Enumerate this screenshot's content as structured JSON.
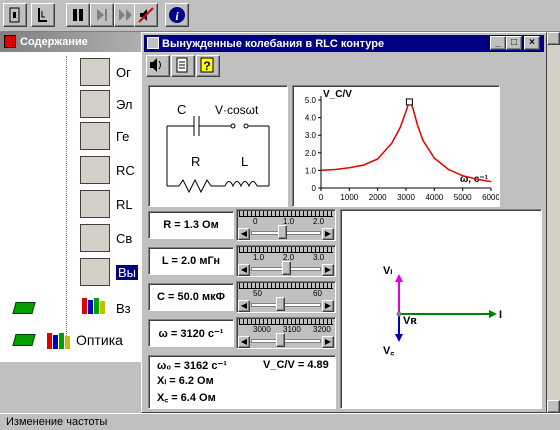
{
  "toolbar": {
    "buttons": [
      "exit-icon",
      "bookmark-icon",
      "pause-icon",
      "step-icon",
      "fast-forward-icon",
      "no-sound-icon",
      "info-icon"
    ]
  },
  "tree": {
    "title": "Содержание",
    "items": [
      {
        "label": "Ог"
      },
      {
        "label": "Эл"
      },
      {
        "label": "Ге"
      },
      {
        "label": "RC"
      },
      {
        "label": "RL"
      },
      {
        "label": "Св"
      },
      {
        "label": "Вы"
      },
      {
        "label": "Вз"
      }
    ],
    "optika": "Оптика"
  },
  "window": {
    "title": "Вынужденные колебания в RLC контуре"
  },
  "circuit": {
    "c": "C",
    "source": "V·cosωt",
    "r": "R",
    "l": "L"
  },
  "chart_data": {
    "type": "line",
    "ylabel": "V_C/V",
    "xlabel": "ω, с⁻¹",
    "xlim": [
      0,
      6000
    ],
    "ylim": [
      0,
      5
    ],
    "xticks": [
      "0",
      "1000",
      "2000",
      "3000",
      "4000",
      "5000",
      "6000"
    ],
    "yticks": [
      "0",
      "1.0",
      "2.0",
      "3.0",
      "4.0",
      "5.0"
    ],
    "series": [
      {
        "x": [
          0,
          500,
          1000,
          1500,
          2000,
          2500,
          2800,
          3000,
          3100,
          3120,
          3162,
          3250,
          3400,
          3600,
          4000,
          4500,
          5000,
          5500,
          6000
        ],
        "y": [
          1.0,
          1.05,
          1.15,
          1.3,
          1.65,
          2.55,
          3.45,
          4.35,
          4.85,
          4.89,
          4.85,
          4.5,
          3.6,
          2.7,
          1.7,
          1.05,
          0.7,
          0.5,
          0.36
        ]
      }
    ],
    "marker": {
      "x": 3120,
      "y": 4.89
    },
    "color": "#e00000"
  },
  "params": [
    {
      "label": "R = 1.3 Ом",
      "scale": [
        "0",
        "1.0",
        "2.0"
      ],
      "value": 0.43
    },
    {
      "label": "L = 2.0 мГн",
      "scale": [
        "1.0",
        "2.0",
        "3.0"
      ],
      "value": 0.5
    },
    {
      "label": "C = 50.0 мкФ",
      "scale": [
        "50",
        "60"
      ],
      "value": 0.4
    },
    {
      "label": "ω = 3120 с⁻¹",
      "scale": [
        "3000",
        "3100",
        "3200"
      ],
      "value": 0.4
    }
  ],
  "results": {
    "w0": "ω₀ = 3162 с⁻¹",
    "xl": "Xₗ = 6.2 Ом",
    "xc": "X꜀ = 6.4 Ом",
    "ratio": "V_C/V = 4.89"
  },
  "vectors": {
    "vl": "Vₗ",
    "vr": "Vʀ",
    "vc": "V꜀",
    "i": "I"
  },
  "status": "Изменение частоты"
}
